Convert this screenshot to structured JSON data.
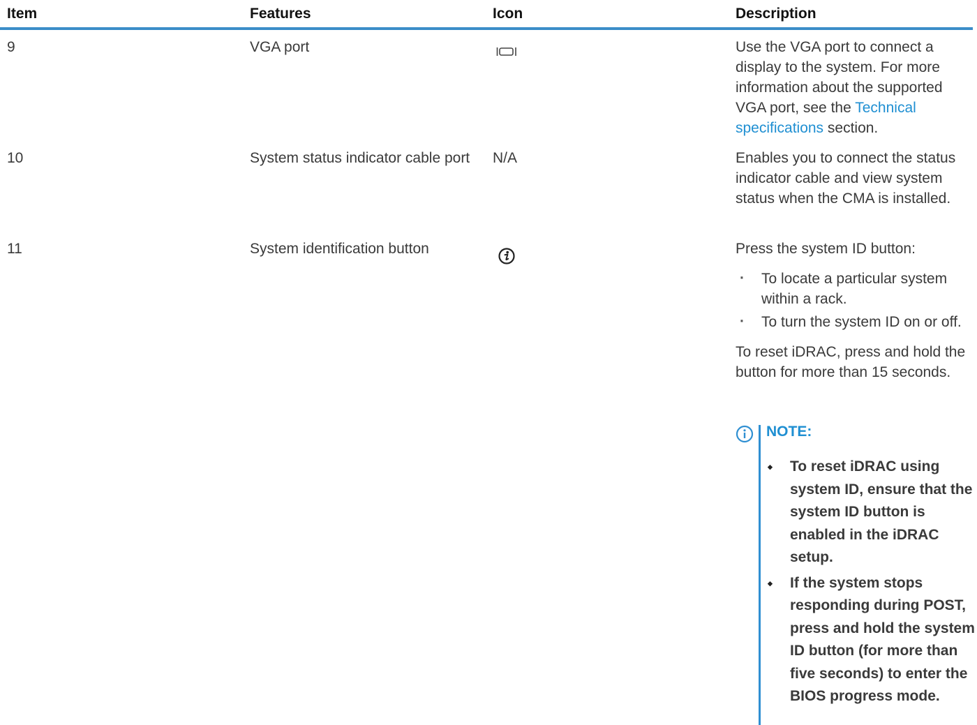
{
  "table": {
    "headers": {
      "item": "Item",
      "features": "Features",
      "icon": "Icon",
      "description": "Description"
    },
    "rows": [
      {
        "item": "9",
        "feature": "VGA port",
        "icon_name": "vga-port-icon",
        "desc_before_link": "Use the VGA port to connect a display to the system. For more information about the supported VGA port, see the ",
        "desc_link": "Technical specifications",
        "desc_after_link": " section."
      },
      {
        "item": "10",
        "feature": "System status indicator cable port",
        "icon_text": "N/A",
        "description": "Enables you to connect the status indicator cable and view system status when the CMA is installed."
      },
      {
        "item": "11",
        "feature": "System identification button",
        "icon_name": "system-id-icon",
        "desc_intro": "Press the system ID button:",
        "desc_bullets": [
          "To locate a particular system within a rack.",
          "To turn the system ID on or off."
        ],
        "desc_after": "To reset iDRAC, press and hold the button for more than 15 seconds.",
        "note": {
          "title": "NOTE:",
          "bullets": [
            "To reset iDRAC using system ID, ensure that the system ID button is enabled in the iDRAC setup.",
            "If the system stops responding during POST, press and hold the system ID button (for more than five seconds) to enter the BIOS progress mode."
          ]
        }
      }
    ]
  },
  "colors": {
    "header_rule": "#3b8dc8",
    "link": "#1f8fd2",
    "note_accent": "#2f8fd2",
    "text": "#3a3a3a"
  }
}
